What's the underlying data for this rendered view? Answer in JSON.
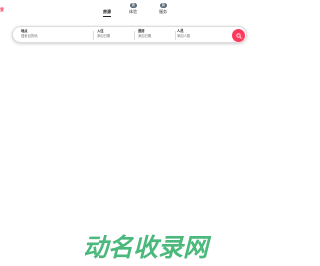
{
  "header": {
    "logo_text": "爱",
    "nav": [
      {
        "label": "房源",
        "active": true
      },
      {
        "label": "体验",
        "badge": "新"
      },
      {
        "label": "服务",
        "badge": "新"
      }
    ]
  },
  "search": {
    "where": {
      "label": "地点",
      "placeholder": "搜索目的地"
    },
    "checkin": {
      "label": "入住",
      "value": "添加日期"
    },
    "checkout": {
      "label": "退房",
      "value": "添加日期"
    },
    "guests": {
      "label": "人员",
      "value": "添加人数"
    },
    "button_icon": "search-icon",
    "accent_color": "#ff385c"
  },
  "watermark": {
    "text": "动名收录网",
    "color": "#3cb371"
  }
}
